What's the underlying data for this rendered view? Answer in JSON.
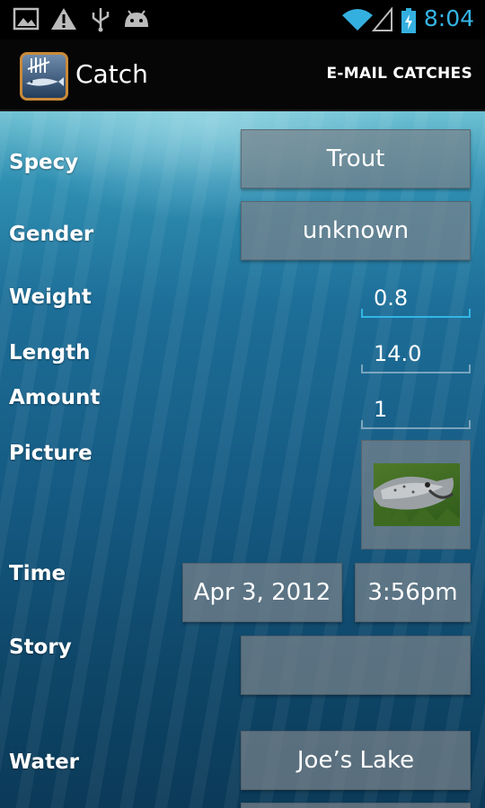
{
  "status_bar": {
    "time": "8:04",
    "icons": [
      "image-icon",
      "warning-icon",
      "usb-icon",
      "android-icon",
      "wifi-icon",
      "signal-icon",
      "battery-charging-icon"
    ]
  },
  "action_bar": {
    "title": "Catch",
    "email_label": "E-MAIL CATCHES"
  },
  "form": {
    "specy": {
      "label": "Specy",
      "value": "Trout"
    },
    "gender": {
      "label": "Gender",
      "value": "unknown"
    },
    "weight": {
      "label": "Weight",
      "value": "0.8"
    },
    "length": {
      "label": "Length",
      "value": "14.0"
    },
    "amount": {
      "label": "Amount",
      "value": "1"
    },
    "picture": {
      "label": "Picture"
    },
    "time": {
      "label": "Time",
      "date": "Apr 3, 2012",
      "clock": "3:56pm"
    },
    "story": {
      "label": "Story",
      "value": ""
    },
    "water": {
      "label": "Water",
      "value": "Joe’s Lake"
    }
  },
  "colors": {
    "accent": "#33b5e5",
    "status_time": "#35b5e5",
    "app_icon_border": "#c98a3a"
  }
}
